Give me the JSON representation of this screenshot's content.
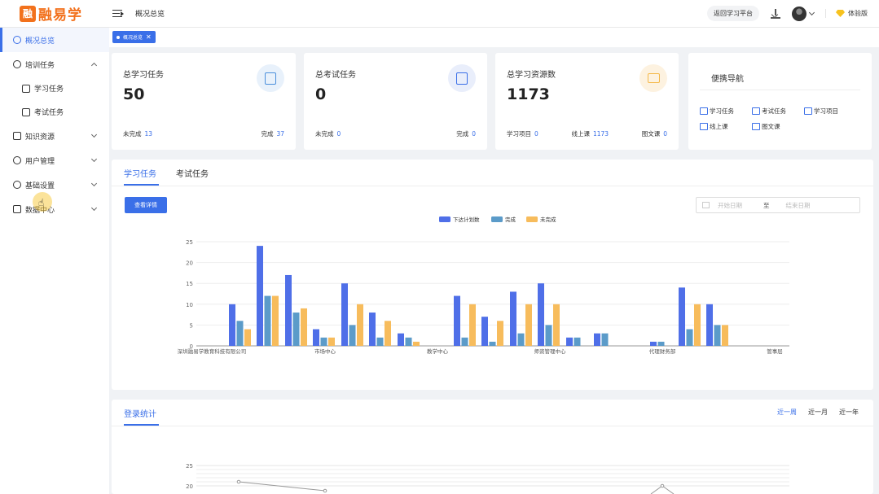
{
  "header": {
    "logo_mark": "融",
    "logo_text": "融易学",
    "title": "概况总览",
    "back_label": "返回学习平台",
    "trial_label": "体验版"
  },
  "sidebar": {
    "items": [
      {
        "label": "概况总览",
        "icon": "dashboard-icon"
      },
      {
        "label": "培训任务",
        "icon": "headset-icon"
      },
      {
        "label": "学习任务",
        "icon": "graduation-cap-icon"
      },
      {
        "label": "考试任务",
        "icon": "document-icon"
      },
      {
        "label": "知识资源",
        "icon": "graduation-cap-icon"
      },
      {
        "label": "用户管理",
        "icon": "users-icon"
      },
      {
        "label": "基础设置",
        "icon": "gear-icon"
      },
      {
        "label": "数据中心",
        "icon": "bar-chart-icon"
      }
    ]
  },
  "tagbar": {
    "tag_label": "概况总览"
  },
  "stats": {
    "study": {
      "title": "总学习任务",
      "value": "50",
      "l1": "未完成",
      "v1": "13",
      "l2": "完成",
      "v2": "37",
      "color": "#4a8fdc"
    },
    "exam": {
      "title": "总考试任务",
      "value": "0",
      "l1": "未完成",
      "v1": "0",
      "l2": "完成",
      "v2": "0",
      "color": "#3a6fe8"
    },
    "resource": {
      "title": "总学习资源数",
      "value": "1173",
      "l1": "学习项目",
      "v1": "0",
      "l2": "线上课",
      "v2": "1173",
      "l3": "图文课",
      "v3": "0",
      "color": "#f5b94a"
    }
  },
  "quick_nav": {
    "title": "便携导航",
    "links": [
      "学习任务",
      "考试任务",
      "学习项目",
      "线上课",
      "图文课"
    ]
  },
  "task_panel": {
    "tabs": [
      "学习任务",
      "考试任务"
    ],
    "detail_button": "查看详情",
    "start_placeholder": "开始日期",
    "range_sep": "至",
    "end_placeholder": "结束日期"
  },
  "chart_data": [
    {
      "type": "bar",
      "categories": [
        "深圳融易学教育科技有限公司",
        "",
        "",
        "",
        "市场中心",
        "",
        "",
        "",
        "教学中心",
        "",
        "",
        "",
        "师资管理中心",
        "",
        "",
        "",
        "",
        "",
        "代理财务部",
        "",
        "",
        "管事层"
      ],
      "tick_labels": [
        "深圳融易学教育科技有限公司",
        "市场中心",
        "教学中心",
        "师资管理中心",
        "代理财务部",
        "管事层"
      ],
      "series": [
        {
          "name": "下达计划数",
          "color": "#4f6fe8",
          "values": [
            10,
            24,
            17,
            4,
            15,
            8,
            3,
            0,
            12,
            7,
            13,
            15,
            2,
            3,
            0,
            1,
            14,
            10,
            0
          ]
        },
        {
          "name": "完成",
          "color": "#5b9bc9",
          "values": [
            6,
            12,
            8,
            2,
            5,
            2,
            2,
            0,
            2,
            1,
            3,
            5,
            2,
            3,
            0,
            1,
            4,
            5,
            0
          ]
        },
        {
          "name": "未完成",
          "color": "#f7bc5c",
          "values": [
            4,
            12,
            9,
            2,
            10,
            6,
            1,
            0,
            10,
            6,
            10,
            10,
            0,
            0,
            0,
            0,
            10,
            5,
            0
          ]
        }
      ],
      "y_ticks": [
        0,
        5,
        10,
        15,
        20,
        25
      ],
      "ylim": [
        0,
        25
      ],
      "legend": "top-center",
      "grid": true
    },
    {
      "type": "line",
      "title": "登录统计",
      "periods": [
        "近一周",
        "近一月",
        "近一年"
      ],
      "y_ticks": [
        20,
        25
      ],
      "ylim": [
        0,
        25
      ]
    }
  ]
}
